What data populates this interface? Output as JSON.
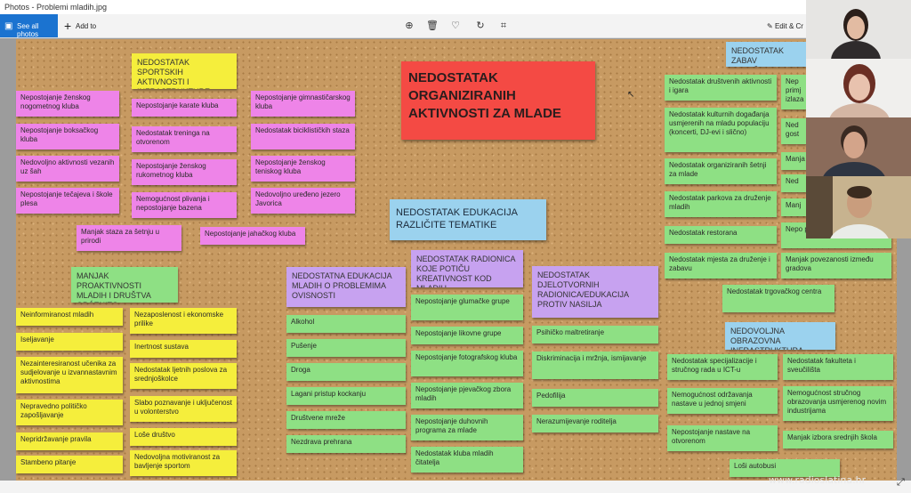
{
  "app": {
    "title": "Photos - Problemi mladih.jpg"
  },
  "toolbar": {
    "see_all": "See all photos",
    "see_all_icon": "photos-icon",
    "add_to": "Add to",
    "add_to_icon": "plus-icon",
    "edit_create": "Edit & Cr",
    "tools": [
      "zoom-in-icon",
      "delete-icon",
      "heart-icon",
      "rotate-icon",
      "crop-icon"
    ]
  },
  "board": {
    "main_title": "NEDOSTATAK ORGANIZIRANIH AKTIVNOSTI ZA MLADE",
    "education_title": "NEDOSTATAK EDUKACIJA RAZLIČITE TEMATIKE",
    "sport": {
      "header": "NEDOSTATAK SPORTSKIH AKTIVNOSTI I INFRASTRUKTURE",
      "notes": [
        "Nepostojanje ženskog nogometnog kluba",
        "Nepostojanje boksačkog kluba",
        "Nedovoljno aktivnosti vezanih uz šah",
        "Nepostojanje tečajeva i škole plesa",
        "Nepostojanje karate kluba",
        "Nedostatak treninga na otvorenom",
        "Nepostojanje ženskog rukometnog kluba",
        "Nemogućnost plivanja i nepostojanje bazena",
        "Nepostojanje gimnastičarskog kluba",
        "Nedostatak biciklističkih staza",
        "Nepostojanje ženskog teniskog kluba",
        "Nedovoljno uređeno jezero Javorica",
        "Manjak staza za šetnju u prirodi",
        "Nepostojanje jahačkog kluba"
      ]
    },
    "proactive": {
      "header": "MANJAK PROAKTIVNOSTI MLADIH I DRUŠTVA OPĆENITO",
      "notes": [
        "Neinformiranost mladih",
        "Iseljavanje",
        "Nezainteresiranost učenika za sudjelovanje u izvannastavnim aktivnostima",
        "Nepravedno političko zapošljavanje",
        "Nepridržavanje pravila",
        "Stambeno pitanje",
        "Nezaposlenost i ekonomske prilike",
        "Inertnost sustava",
        "Nedostatak ljetnih poslova za srednjoškolce",
        "Slabo poznavanje i uključenost u volonterstvo",
        "Loše društvo",
        "Nedovoljna motiviranost za bavljenje sportom"
      ]
    },
    "addiction": {
      "header": "NEDOSTATNA EDUKACIJA MLADIH O PROBLEMIMA OVISNOSTI",
      "notes": [
        "Alkohol",
        "Pušenje",
        "Droga",
        "Lagani pristup kockanju",
        "Društvene mreže",
        "Nezdrava prehrana"
      ]
    },
    "creative": {
      "header": "NEDOSTATAK RADIONICA KOJE POTIČU KREATIVNOST KOD MLADIH",
      "notes": [
        "Nepostojanje glumačke grupe",
        "Nepostojanje likovne grupe",
        "Nepostojanje fotografskog kluba",
        "Nepostojanje pjevačkog zbora mladih",
        "Nepostojanje duhovnih programa za mlade",
        "Nedostatak kluba mladih čitatelja"
      ]
    },
    "violence": {
      "header": "NEDOSTATAK DJELOTVORNIH RADIONICA/EDUKACIJA PROTIV NASILJA",
      "notes": [
        "Psihičko maltretiranje",
        "Diskriminacija i mržnja, ismijavanje",
        "Pedofilija",
        "Nerazumijevanje roditelja"
      ]
    },
    "entertainment": {
      "header": "NEDOSTATAK ZABAV SADRŽAJA",
      "notes": [
        "Nedostatak društvenih aktivnosti i igara",
        "Nedostatak kulturnih događanja usmjerenih na mladu populaciju (koncerti, DJ-evi i slično)",
        "Nedostatak organiziranih šetnji za mlade",
        "Nedostatak parkova za druženje mladih",
        "Nedostatak restorana",
        "Nedostatak mjesta za druženje i zabavu",
        "Nedostatak trgovačkog centra"
      ],
      "partial_notes": [
        "Nep primj izlaza",
        "Ned gost",
        "Manja",
        "Ned",
        "Manj",
        "Nepo putova"
      ],
      "partial_long": "Manjak povezanosti između gradova"
    },
    "edu_infra": {
      "header": "NEDOVOLJNA OBRAZOVNA INFRASTRUKTURA",
      "notes": [
        "Nedostatak specijalizacije i stručnog rada u ICT-u",
        "Nemogućnost održavanja nastave u jednoj smjeni",
        "Nepostojanje nastave na otvorenom",
        "Loši autobusi",
        "Nedostatak fakulteta i sveučilišta",
        "Nemogućnost stručnog obrazovanja usmjerenog novim industrijama",
        "Manjak izbora srednjih škola"
      ]
    }
  },
  "watermark": "www.radioslatina.hr"
}
